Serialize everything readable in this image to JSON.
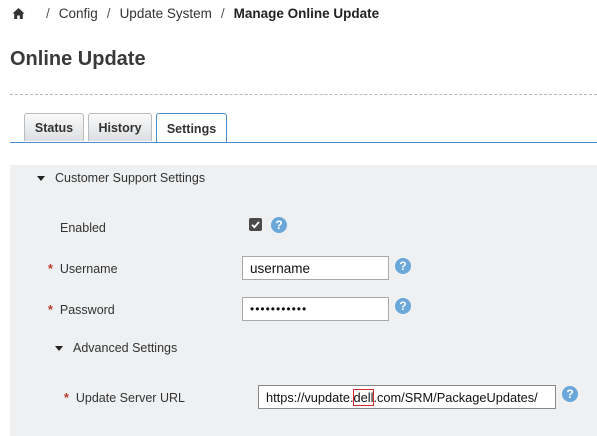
{
  "breadcrumb": {
    "home_icon": "home-icon",
    "items": [
      "Config",
      "Update System"
    ],
    "current": "Manage Online Update",
    "separator": "/"
  },
  "page": {
    "title": "Online Update"
  },
  "tabs": [
    {
      "label": "Status",
      "active": false
    },
    {
      "label": "History",
      "active": false
    },
    {
      "label": "Settings",
      "active": true
    }
  ],
  "customer_support": {
    "header": "Customer Support Settings",
    "expanded": true,
    "enabled": {
      "label": "Enabled",
      "checked": true
    },
    "username": {
      "label": "Username",
      "value": "username",
      "required": true
    },
    "password": {
      "label": "Password",
      "value": "•••••••••••",
      "required": true
    },
    "help_icon": "question-circle-icon"
  },
  "advanced": {
    "header": "Advanced Settings",
    "expanded": true,
    "update_server_url": {
      "label": "Update Server URL",
      "required": true,
      "value_prefix": "https://vupdate.",
      "value_highlight": "dell",
      "value_suffix": ".com/SRM/PackageUpdates/"
    }
  },
  "required_marker": "*",
  "colors": {
    "accent": "#4a8ac7",
    "help_icon": "#6ba7d8",
    "required": "#c0392b",
    "panel_bg": "#eef0f2",
    "highlight_box": "#d62b2b"
  }
}
